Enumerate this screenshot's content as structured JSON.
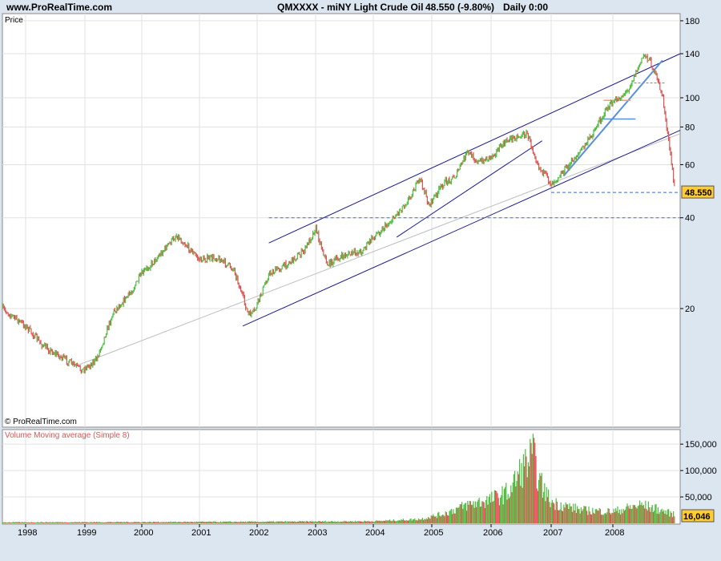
{
  "header": {
    "site": "www.ProRealTime.com",
    "instrument": "QMXXXX - miNY Light Crude Oil",
    "last": "48.550 (-9.80%)",
    "timeframe": "Daily  0:00"
  },
  "price_panel": {
    "label": "Price",
    "copyright": "© ProRealTime.com",
    "last_tag": "48.550"
  },
  "volume_panel": {
    "label": "Volume Moving average (Simple 8)",
    "last_tag": "16,046"
  },
  "colors": {
    "up": "#4bbf3c",
    "down": "#e05454",
    "channel": "#1a1a8a",
    "trend_light": "#5a8fe0",
    "dashed": "#3b6bd8",
    "tag_bg": "#ffcc33"
  },
  "chart_data": [
    {
      "type": "line",
      "title": "QMXXXX - miNY Light Crude Oil",
      "ylabel": "Price",
      "yscale": "log",
      "ylim": [
        13.5,
        190
      ],
      "xlim": [
        1997.7,
        2008.95
      ],
      "x_ticks": [
        "1998",
        "1999",
        "2000",
        "2001",
        "2002",
        "2003",
        "2004",
        "2005",
        "2006",
        "2007",
        "2008"
      ],
      "y_ticks": [
        20,
        40,
        60,
        80,
        100,
        140,
        180
      ],
      "grid": true,
      "series": [
        {
          "x": [
            1997.7,
            1998.0,
            1998.3,
            1998.6,
            1998.95,
            1999.2,
            1999.5,
            1999.8,
            2000.0,
            2000.3,
            2000.6,
            2000.8,
            2001.0,
            2001.3,
            2001.6,
            2001.85,
            2001.95,
            2002.2,
            2002.5,
            2002.8,
            2003.0,
            2003.2,
            2003.5,
            2003.8,
            2004.0,
            2004.3,
            2004.6,
            2004.8,
            2004.95,
            2005.2,
            2005.4,
            2005.6,
            2005.8,
            2006.0,
            2006.3,
            2006.6,
            2006.8,
            2007.0,
            2007.3,
            2007.6,
            2007.9,
            2008.0,
            2008.2,
            2008.45,
            2008.55,
            2008.7,
            2008.8,
            2008.88
          ],
          "y": [
            20.0,
            17.5,
            15.0,
            13.8,
            12.5,
            13.5,
            19.5,
            22.5,
            26.0,
            30.0,
            35.0,
            32.0,
            29.0,
            29.5,
            27.0,
            19.0,
            19.5,
            26.0,
            28.0,
            31.0,
            37.0,
            28.0,
            30.0,
            31.0,
            34.5,
            39.0,
            46.0,
            54.0,
            44.0,
            52.0,
            55.0,
            66.0,
            61.0,
            64.0,
            73.0,
            76.0,
            59.0,
            52.0,
            60.0,
            72.0,
            92.0,
            96.0,
            105.0,
            140.0,
            129.0,
            102.0,
            68.0,
            48.55
          ]
        }
      ],
      "annotations": [
        "48.550"
      ]
    },
    {
      "type": "bar",
      "title": "Volume Moving average (Simple 8)",
      "y_ticks": [
        50000,
        100000,
        150000
      ],
      "ylim": [
        0,
        170000
      ],
      "series": [
        {
          "x": [
            1997.7,
            2002.0,
            2004.0,
            2004.8,
            2005.2,
            2005.6,
            2006.0,
            2006.3,
            2006.5,
            2006.7,
            2006.8,
            2007.0,
            2007.5,
            2008.0,
            2008.4,
            2008.6,
            2008.88
          ],
          "y": [
            2000,
            3000,
            4000,
            8000,
            18000,
            35000,
            45000,
            60000,
            100000,
            130000,
            80000,
            40000,
            25000,
            22000,
            35000,
            28000,
            16046
          ]
        }
      ],
      "annotations": [
        "16,046"
      ]
    }
  ]
}
